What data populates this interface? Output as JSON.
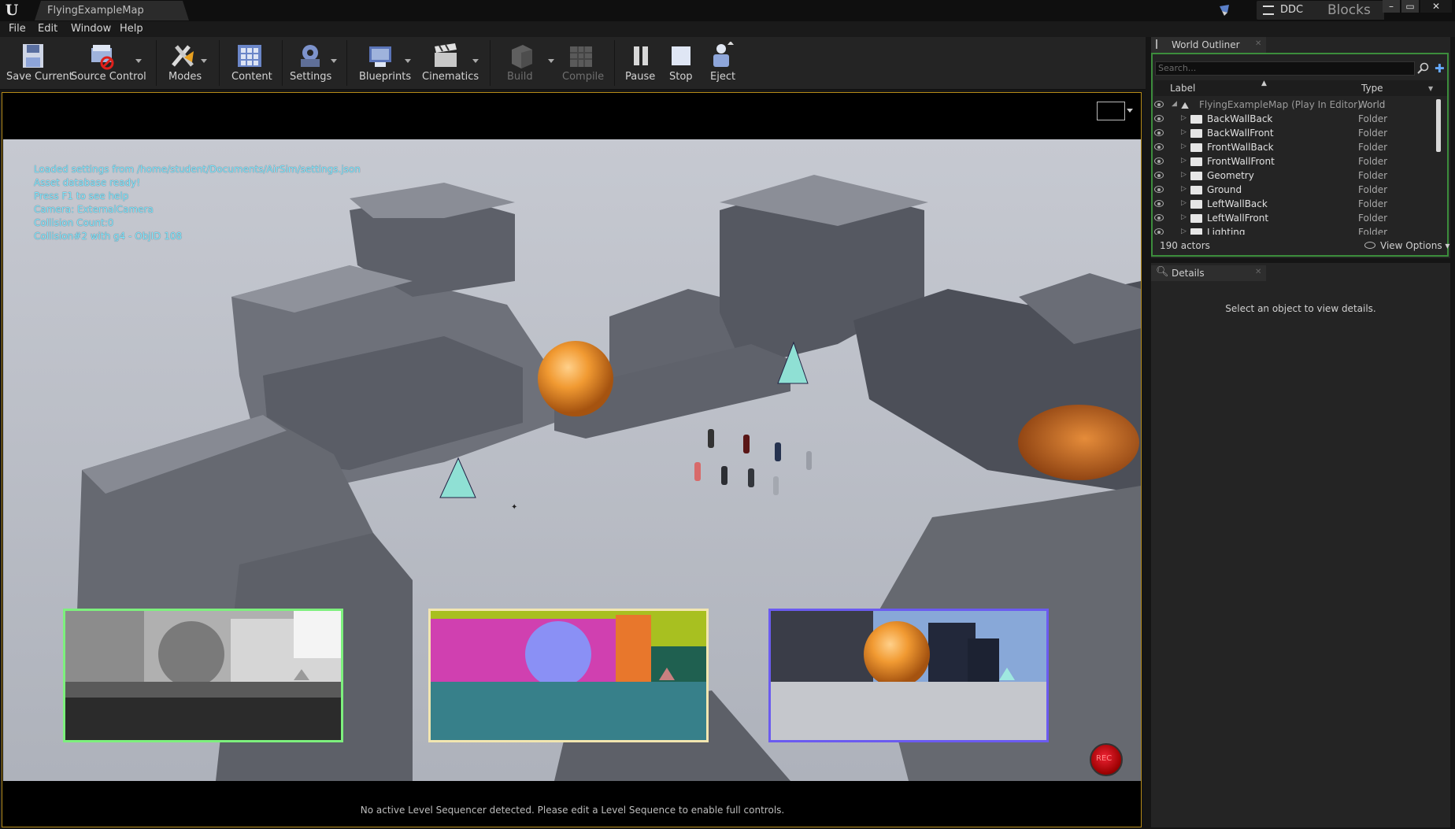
{
  "window": {
    "document_tab": "FlyingExampleMap",
    "ddc_label": "DDC",
    "project_label": "Blocks",
    "controls": [
      "–",
      "▭",
      "✕"
    ]
  },
  "menu": [
    "File",
    "Edit",
    "Window",
    "Help"
  ],
  "toolbar": {
    "buttons": [
      {
        "label": "Save Current",
        "icon": "save-icon",
        "enabled": true
      },
      {
        "label": "Source Control",
        "icon": "source-control-icon",
        "enabled": true
      },
      {
        "label": "Modes",
        "icon": "modes-icon",
        "enabled": true
      },
      {
        "label": "Content",
        "icon": "content-icon",
        "enabled": true
      },
      {
        "label": "Settings",
        "icon": "settings-icon",
        "enabled": true
      },
      {
        "label": "Blueprints",
        "icon": "blueprints-icon",
        "enabled": true
      },
      {
        "label": "Cinematics",
        "icon": "cinematics-icon",
        "enabled": true
      },
      {
        "label": "Build",
        "icon": "build-icon",
        "enabled": false
      },
      {
        "label": "Compile",
        "icon": "compile-icon",
        "enabled": false
      },
      {
        "label": "Pause",
        "icon": "pause-icon",
        "enabled": true
      },
      {
        "label": "Stop",
        "icon": "stop-icon",
        "enabled": true
      },
      {
        "label": "Eject",
        "icon": "eject-icon",
        "enabled": true
      }
    ]
  },
  "viewport": {
    "hud_lines": [
      "Loaded settings from /home/student/Documents/AirSim/settings.json",
      "Asset database ready!",
      "Press F1 to see help",
      "Camera: ExternalCamera",
      "Collision Count:0",
      "Collision#2 with g4 - ObjID 108"
    ],
    "sequencer_message": "No active Level Sequencer detected. Please edit a Level Sequence to enable full controls.",
    "rec_label": "REC",
    "subwindow_colors": [
      "#7df07d",
      "#f2e6b0",
      "#6b5bf0"
    ]
  },
  "outliner": {
    "tab_label": "World Outliner",
    "search_placeholder": "Search...",
    "columns": {
      "label": "Label",
      "type": "Type"
    },
    "rows": [
      {
        "name": "FlyingExampleMap (Play In Editor)",
        "type": "World"
      },
      {
        "name": "BackWallBack",
        "type": "Folder"
      },
      {
        "name": "BackWallFront",
        "type": "Folder"
      },
      {
        "name": "FrontWallBack",
        "type": "Folder"
      },
      {
        "name": "FrontWallFront",
        "type": "Folder"
      },
      {
        "name": "Geometry",
        "type": "Folder"
      },
      {
        "name": "Ground",
        "type": "Folder"
      },
      {
        "name": "LeftWallBack",
        "type": "Folder"
      },
      {
        "name": "LeftWallFront",
        "type": "Folder"
      },
      {
        "name": "Lighting",
        "type": "Folder"
      }
    ],
    "actor_count": "190 actors",
    "view_options": "View Options"
  },
  "details": {
    "tab_label": "Details",
    "empty_message": "Select an object to view details."
  }
}
